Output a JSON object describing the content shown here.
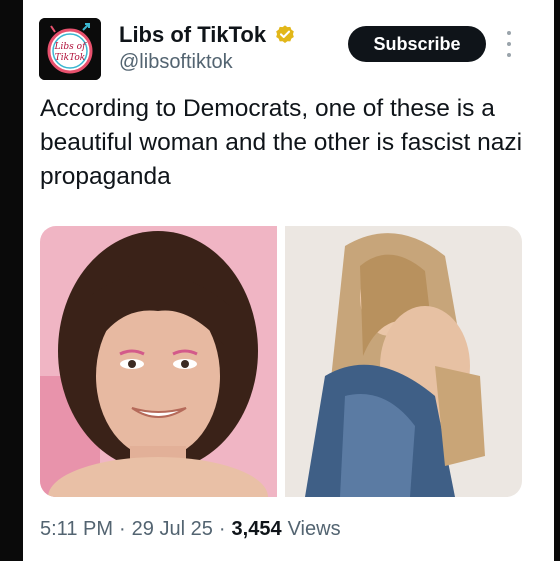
{
  "author": {
    "name": "Libs of TikTok",
    "handle": "@libsoftiktok",
    "avatar_text_line1": "Libs of",
    "avatar_text_line2": "TikTok",
    "verified_icon": "verified-badge-gold"
  },
  "actions": {
    "subscribe_label": "Subscribe",
    "more_icon": "more-vertical-icon"
  },
  "tweet": {
    "text": "According to Democrats, one of these is a beautiful woman and the other is fascist nazi propaganda",
    "media": [
      {
        "description_icon": "photo-left"
      },
      {
        "description_icon": "photo-right"
      }
    ]
  },
  "meta": {
    "time": "5:11 PM",
    "separator1": "·",
    "date": "29 Jul 25",
    "separator2": "·",
    "views_count": "3,454",
    "views_label": "Views"
  },
  "colors": {
    "text_primary": "#0f1419",
    "text_secondary": "#536471",
    "badge_gold": "#e2b719",
    "button_bg": "#0f1419"
  }
}
